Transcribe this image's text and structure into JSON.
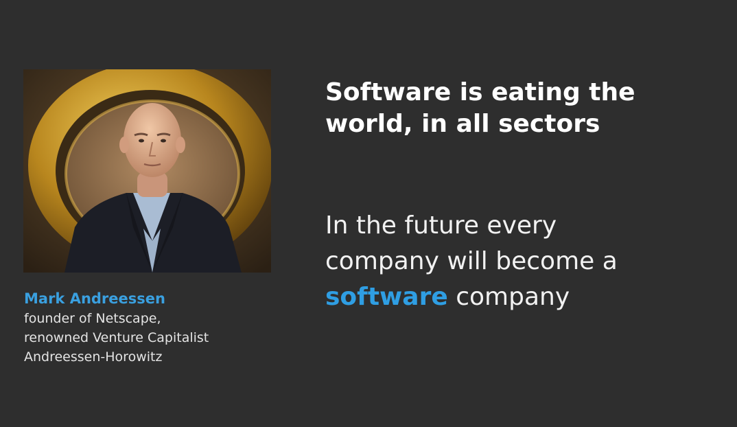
{
  "caption": {
    "name": "Mark Andreessen",
    "lines": [
      "founder of Netscape,",
      "renowned Venture Capitalist",
      "Andreessen-Horowitz"
    ]
  },
  "headline": {
    "lines": [
      "Software is eating the",
      "world, in all sectors"
    ]
  },
  "quote": {
    "line1": "In the future every",
    "line2": "company will become a",
    "highlight": "software",
    "line3_rest": " company"
  },
  "colors": {
    "background": "#2e2e2e",
    "accent": "#2f9ee3",
    "text": "#ffffff"
  }
}
